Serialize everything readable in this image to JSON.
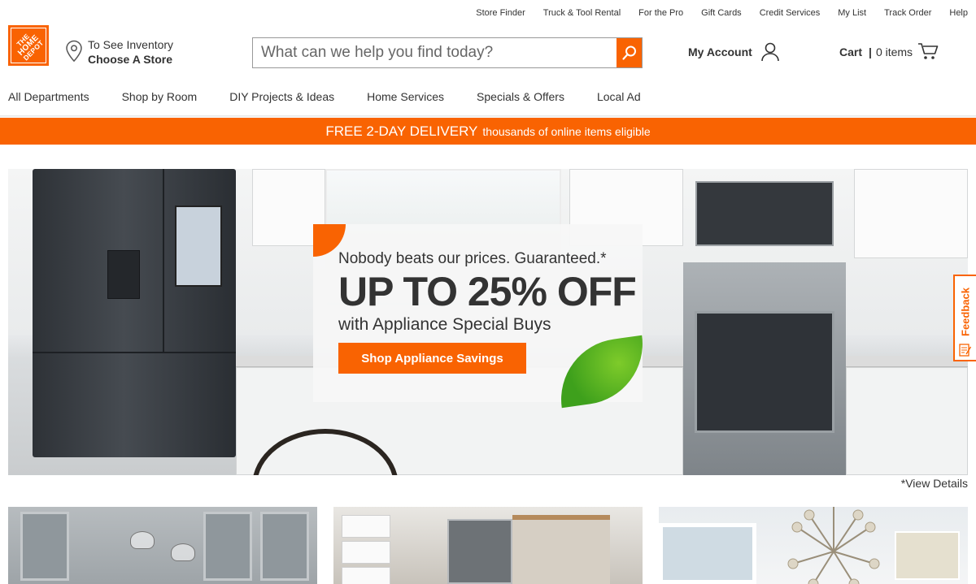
{
  "utility_links": [
    "Store Finder",
    "Truck & Tool Rental",
    "For the Pro",
    "Gift Cards",
    "Credit Services",
    "My List",
    "Track Order",
    "Help"
  ],
  "logo": {
    "text_top": "THE",
    "text_mid": "HOME",
    "text_bottom": "DEPOT"
  },
  "store": {
    "line1": "To See Inventory",
    "line2": "Choose A Store"
  },
  "search": {
    "placeholder": "What can we help you find today?",
    "value": ""
  },
  "account": {
    "label": "My Account"
  },
  "cart": {
    "label": "Cart",
    "separator": "|",
    "count": "0 items"
  },
  "nav": [
    "All Departments",
    "Shop by Room",
    "DIY Projects & Ideas",
    "Home Services",
    "Specials & Offers",
    "Local Ad"
  ],
  "promo": {
    "headline": "FREE 2-DAY DELIVERY",
    "sub": "thousands of online items eligible"
  },
  "hero": {
    "line1": "Nobody beats our prices. Guaranteed.*",
    "line2": "UP TO 25% OFF",
    "line3": "with Appliance Special Buys",
    "cta": "Shop Appliance Savings",
    "view_details": "*View Details"
  },
  "feedback": {
    "label": "Feedback"
  },
  "colors": {
    "brand_orange": "#f96302",
    "text": "#333333"
  },
  "icons": [
    "map-pin-icon",
    "search-icon",
    "user-icon",
    "cart-icon",
    "feedback-icon"
  ]
}
